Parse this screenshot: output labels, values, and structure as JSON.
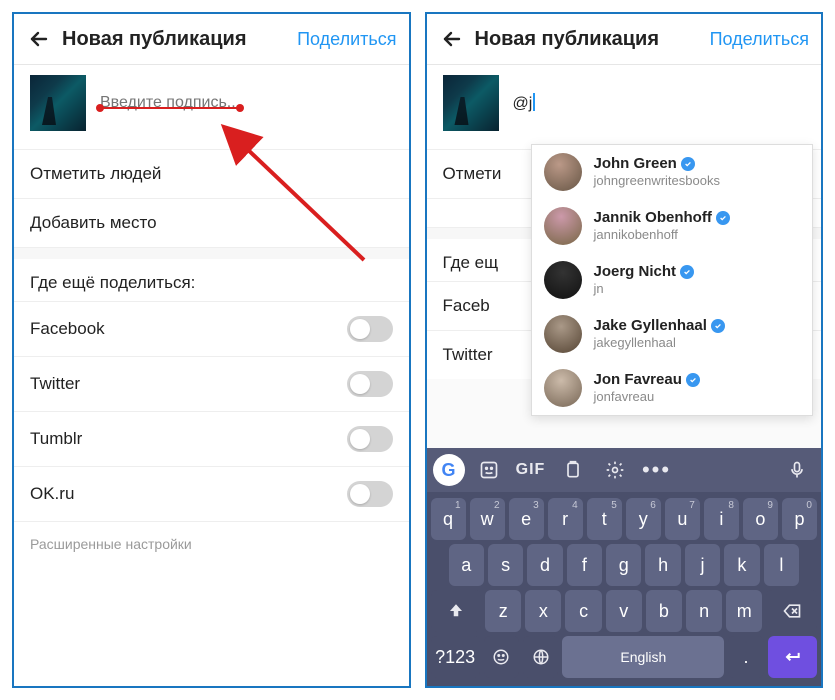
{
  "left": {
    "title": "Новая публикация",
    "share": "Поделиться",
    "caption_placeholder": "Введите подпись...",
    "tag_people": "Отметить людей",
    "add_place": "Добавить место",
    "where_else": "Где ещё поделиться:",
    "networks": [
      "Facebook",
      "Twitter",
      "Tumblr",
      "OK.ru"
    ],
    "advanced": "Расширенные настройки"
  },
  "right": {
    "title": "Новая публикация",
    "share": "Поделиться",
    "caption_value": "@j",
    "tag_people": "Отмети",
    "add_place": "",
    "where_else": "Где ещ",
    "networks_visible": [
      "Faceb",
      "Twitter"
    ],
    "suggestions": [
      {
        "name": "John Green",
        "user": "johngreenwritesbooks"
      },
      {
        "name": "Jannik Obenhoff",
        "user": "jannikobenhoff"
      },
      {
        "name": "Joerg Nicht",
        "user": "jn"
      },
      {
        "name": "Jake Gyllenhaal",
        "user": "jakegyllenhaal"
      },
      {
        "name": "Jon Favreau",
        "user": "jonfavreau"
      }
    ],
    "keyboard": {
      "gif": "GIF",
      "row1": [
        [
          "q",
          "1"
        ],
        [
          "w",
          "2"
        ],
        [
          "e",
          "3"
        ],
        [
          "r",
          "4"
        ],
        [
          "t",
          "5"
        ],
        [
          "y",
          "6"
        ],
        [
          "u",
          "7"
        ],
        [
          "i",
          "8"
        ],
        [
          "o",
          "9"
        ],
        [
          "p",
          "0"
        ]
      ],
      "row2": [
        "a",
        "s",
        "d",
        "f",
        "g",
        "h",
        "j",
        "k",
        "l"
      ],
      "row3": [
        "z",
        "x",
        "c",
        "v",
        "b",
        "n",
        "m"
      ],
      "mode": "?123",
      "comma": ",",
      "lang": "English",
      "period": "."
    }
  }
}
